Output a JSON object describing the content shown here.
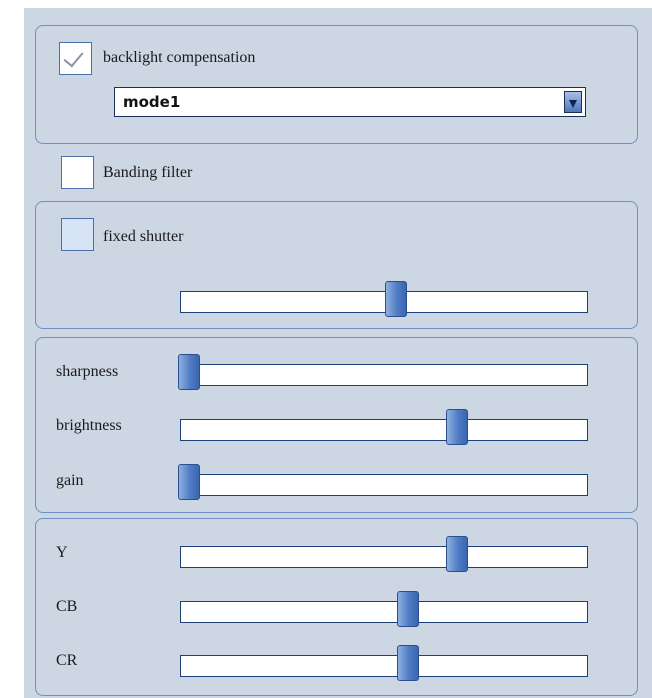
{
  "backlight": {
    "label": "backlight compensation",
    "checked": true,
    "mode": "mode1"
  },
  "banding": {
    "label": "Banding filter",
    "checked": false
  },
  "shutter": {
    "label": "fixed shutter",
    "checked": false,
    "value": 0.53
  },
  "sliders": {
    "sharpness": {
      "label": "sharpness",
      "value": 0.02
    },
    "brightness": {
      "label": "brightness",
      "value": 0.68
    },
    "gain": {
      "label": "gain",
      "value": 0.02
    },
    "y": {
      "label": "Y",
      "value": 0.68
    },
    "cb": {
      "label": "CB",
      "value": 0.56
    },
    "cr": {
      "label": "CR",
      "value": 0.56
    }
  },
  "icons": {
    "checkmark": "check-icon",
    "dropdown": "chevron-down-icon"
  },
  "colors": {
    "panel": "#cdd6e3",
    "border": "#6f8fc4",
    "thumb": "#4f7cc4"
  }
}
